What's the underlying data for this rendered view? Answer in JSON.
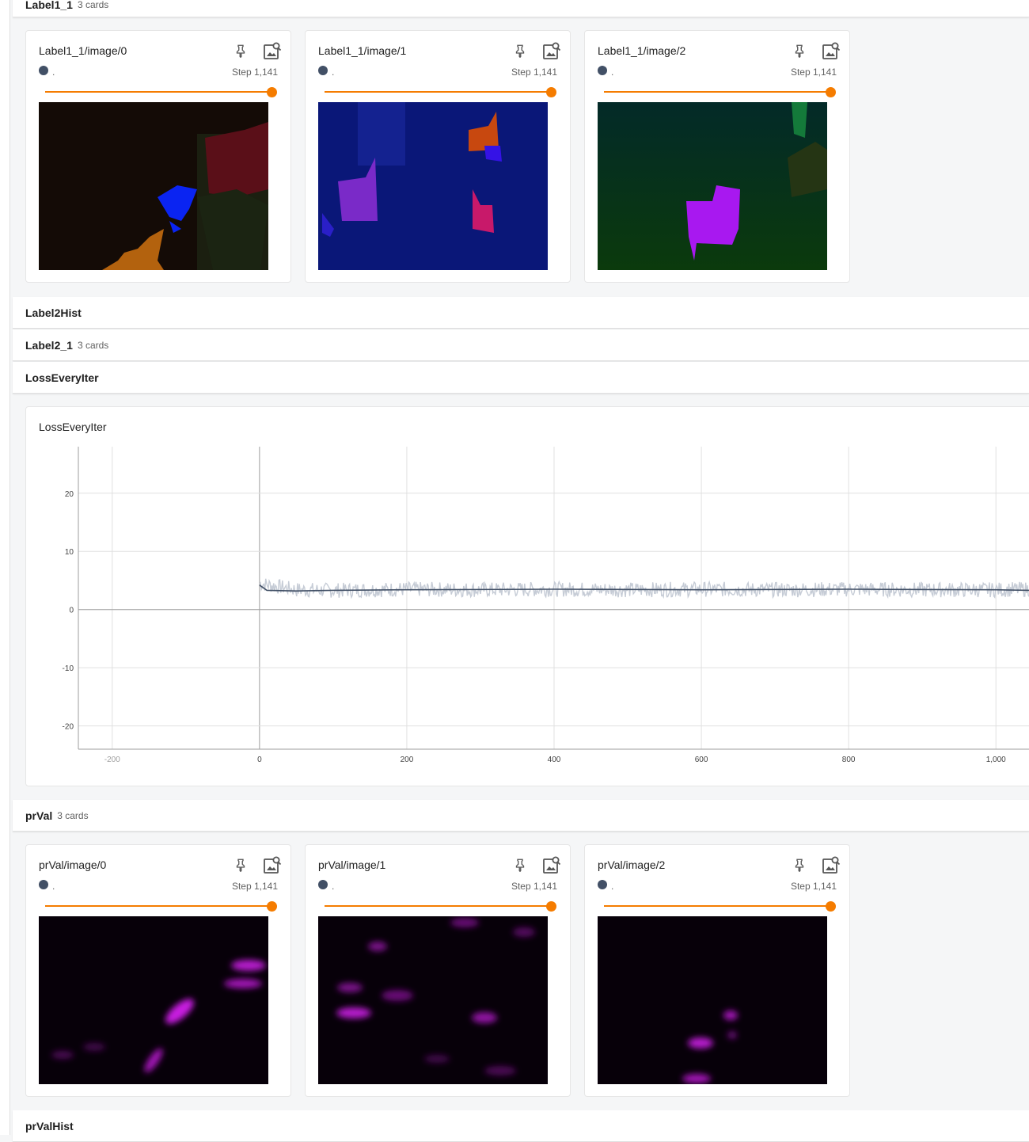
{
  "groups": {
    "label1": {
      "name": "Label1_1",
      "count": "3 cards"
    },
    "label2hist": {
      "name": "Label2Hist"
    },
    "label2": {
      "name": "Label2_1",
      "count": "3 cards"
    },
    "loss": {
      "name": "LossEveryIter"
    },
    "prval": {
      "name": "prVal",
      "count": "3 cards"
    },
    "prvalhist": {
      "name": "prValHist"
    }
  },
  "label1_cards": [
    {
      "title": "Label1_1/image/0",
      "run": ".",
      "step": "Step 1,141",
      "slider_fraction": 1.0
    },
    {
      "title": "Label1_1/image/1",
      "run": ".",
      "step": "Step 1,141",
      "slider_fraction": 1.0
    },
    {
      "title": "Label1_1/image/2",
      "run": ".",
      "step": "Step 1,141",
      "slider_fraction": 1.0
    }
  ],
  "prval_cards": [
    {
      "title": "prVal/image/0",
      "run": ".",
      "step": "Step 1,141",
      "slider_fraction": 1.0
    },
    {
      "title": "prVal/image/1",
      "run": ".",
      "step": "Step 1,141",
      "slider_fraction": 1.0
    },
    {
      "title": "prVal/image/2",
      "run": ".",
      "step": "Step 1,141",
      "slider_fraction": 1.0
    }
  ],
  "scalar_card": {
    "title": "LossEveryIter"
  },
  "icons": {
    "pin": "pin-icon",
    "zoom": "image-search-icon",
    "run_dot": "run-color-dot"
  },
  "colors": {
    "accent": "#f57c00",
    "run": "#425066",
    "raw_line": "#c6ccd6",
    "smoothed_line": "#425066"
  },
  "chart_data": {
    "type": "line",
    "title": "LossEveryIter",
    "xlabel": "",
    "ylabel": "",
    "xlim": [
      -246,
      1046
    ],
    "ylim": [
      -24,
      28
    ],
    "x_ticks": [
      "-200",
      "0",
      "200",
      "400",
      "600",
      "800",
      "1,000"
    ],
    "y_ticks": [
      "20",
      "10",
      "0",
      "-10",
      "-20"
    ],
    "grid": true,
    "series": [
      {
        "values_summary": "raw",
        "x": [
          0,
          50,
          100,
          200,
          300,
          400,
          500,
          600,
          700,
          800,
          900,
          1000,
          1046
        ],
        "y": [
          4.5,
          3.4,
          3.3,
          3.5,
          3.4,
          3.5,
          3.4,
          3.5,
          3.4,
          3.5,
          3.4,
          3.4,
          3.5
        ]
      },
      {
        "values_summary": "smoothed",
        "x": [
          0,
          10,
          50,
          100,
          200,
          400,
          600,
          800,
          1000,
          1046
        ],
        "y": [
          4.2,
          3.3,
          3.2,
          3.3,
          3.4,
          3.5,
          3.4,
          3.5,
          3.4,
          3.3
        ]
      }
    ]
  }
}
